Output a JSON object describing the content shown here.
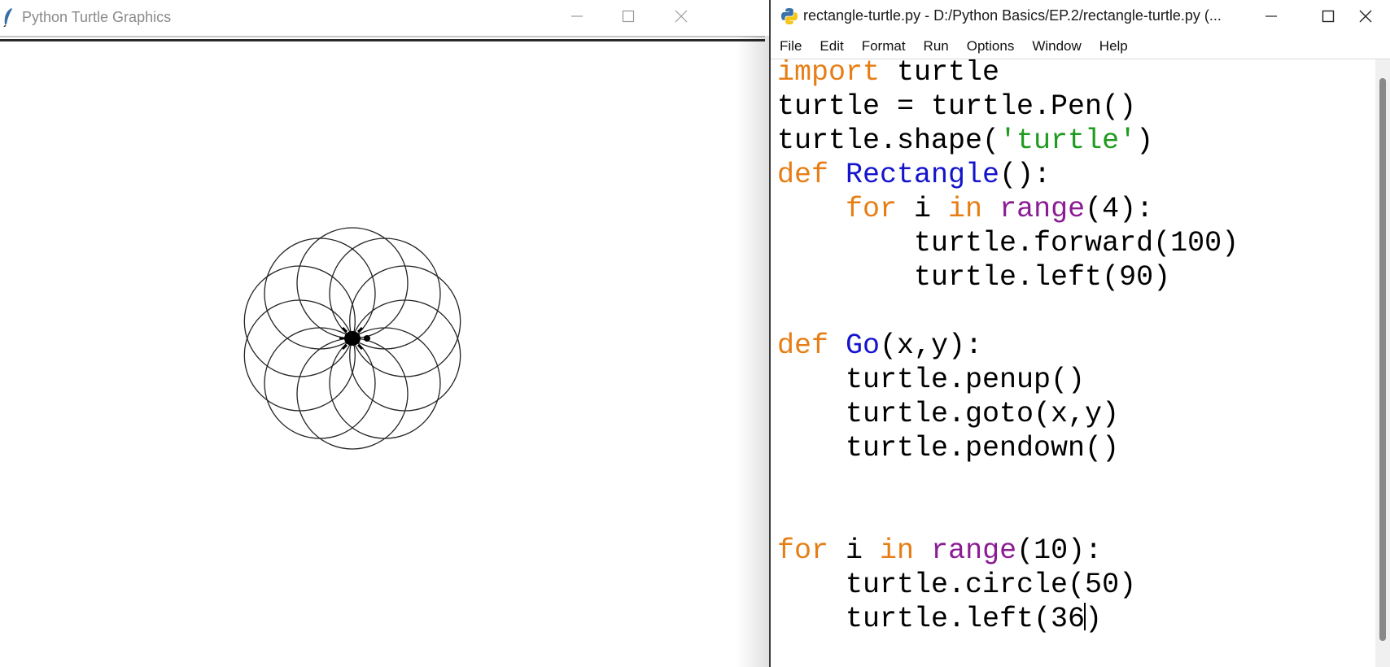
{
  "turtle_window": {
    "title": "Python Turtle Graphics"
  },
  "editor_window": {
    "title": "rectangle-turtle.py - D:/Python Basics/EP.2/rectangle-turtle.py (...",
    "menu": [
      "File",
      "Edit",
      "Format",
      "Run",
      "Options",
      "Window",
      "Help"
    ]
  },
  "drawing": {
    "circle_count": 10,
    "circle_radius": 50,
    "turn_angle": 36,
    "stroke_color": "#222222"
  },
  "code": {
    "lines": [
      [
        {
          "t": "import",
          "k": "kw"
        },
        {
          "t": " turtle"
        }
      ],
      [
        {
          "t": "turtle = turtle.Pen()"
        }
      ],
      [
        {
          "t": "turtle.shape("
        },
        {
          "t": "'turtle'",
          "k": "st"
        },
        {
          "t": ")"
        }
      ],
      [
        {
          "t": "def",
          "k": "kw"
        },
        {
          "t": " "
        },
        {
          "t": "Rectangle",
          "k": "fn"
        },
        {
          "t": "():"
        }
      ],
      [
        {
          "t": "    "
        },
        {
          "t": "for",
          "k": "kw"
        },
        {
          "t": " i "
        },
        {
          "t": "in",
          "k": "kw"
        },
        {
          "t": " "
        },
        {
          "t": "range",
          "k": "bi"
        },
        {
          "t": "(4):"
        }
      ],
      [
        {
          "t": "        turtle.forward(100)"
        }
      ],
      [
        {
          "t": "        turtle.left(90)"
        }
      ],
      [],
      [
        {
          "t": "def",
          "k": "kw"
        },
        {
          "t": " "
        },
        {
          "t": "Go",
          "k": "fn"
        },
        {
          "t": "(x,y):"
        }
      ],
      [
        {
          "t": "    turtle.penup()"
        }
      ],
      [
        {
          "t": "    turtle.goto(x,y)"
        }
      ],
      [
        {
          "t": "    turtle.pendown()"
        }
      ],
      [],
      [],
      [
        {
          "t": "for",
          "k": "kw"
        },
        {
          "t": " i "
        },
        {
          "t": "in",
          "k": "kw"
        },
        {
          "t": " "
        },
        {
          "t": "range",
          "k": "bi"
        },
        {
          "t": "(10):"
        }
      ],
      [
        {
          "t": "    turtle.circle(50)"
        }
      ],
      [
        {
          "t": "    turtle.left(36"
        },
        {
          "caret": true
        },
        {
          "t": ")"
        }
      ]
    ]
  },
  "colors": {
    "keyword": "#e67e15",
    "builtin": "#8b1c94",
    "definition": "#1414cc",
    "string": "#1e9a1e"
  }
}
